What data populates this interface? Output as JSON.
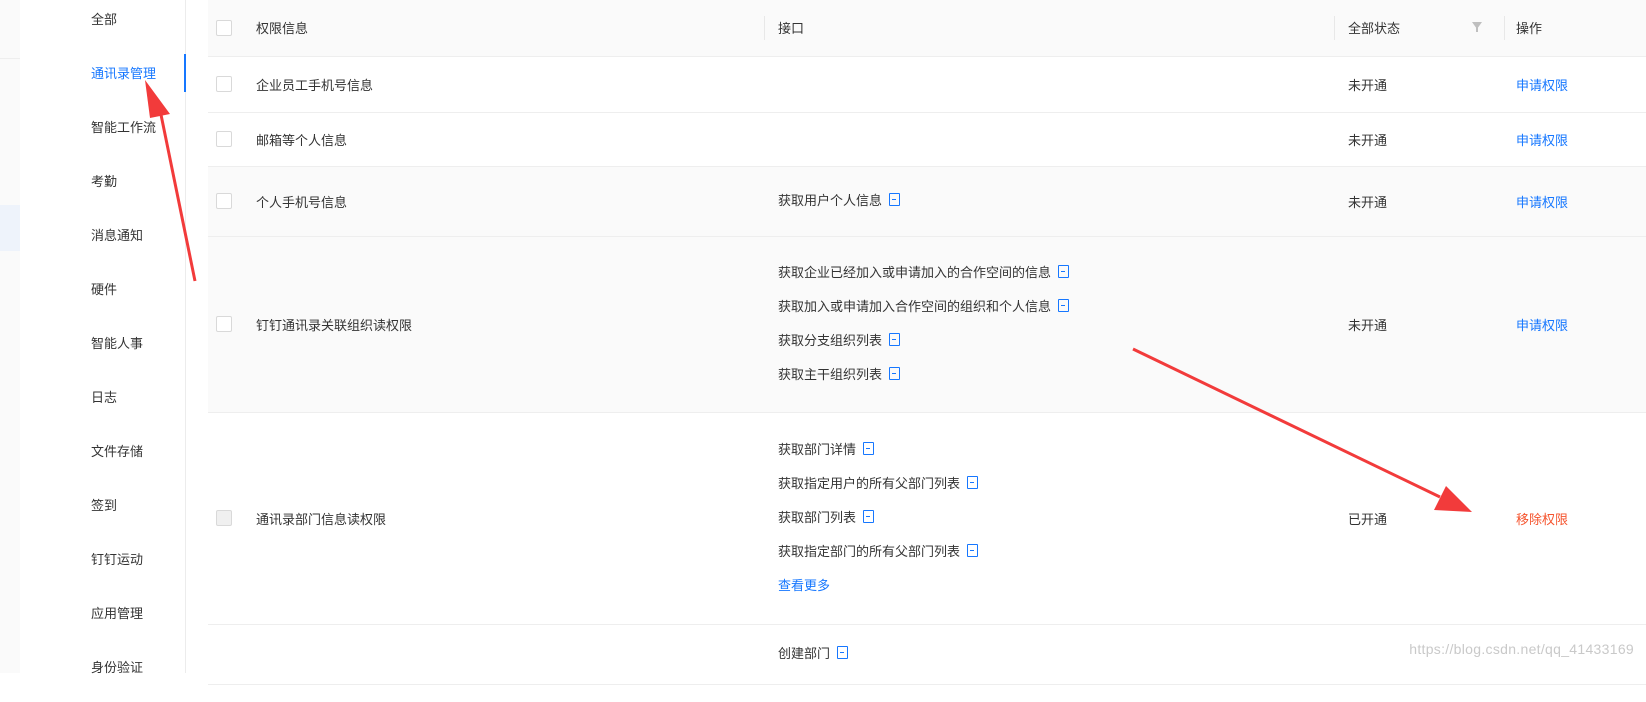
{
  "sidebar": {
    "items": [
      {
        "label": "全部",
        "active": false
      },
      {
        "label": "通讯录管理",
        "active": true
      },
      {
        "label": "智能工作流",
        "active": false
      },
      {
        "label": "考勤",
        "active": false
      },
      {
        "label": "消息通知",
        "active": false
      },
      {
        "label": "硬件",
        "active": false
      },
      {
        "label": "智能人事",
        "active": false
      },
      {
        "label": "日志",
        "active": false
      },
      {
        "label": "文件存储",
        "active": false
      },
      {
        "label": "签到",
        "active": false
      },
      {
        "label": "钉钉运动",
        "active": false
      },
      {
        "label": "应用管理",
        "active": false
      },
      {
        "label": "身份验证",
        "active": false
      }
    ]
  },
  "table": {
    "headers": {
      "name": "权限信息",
      "api": "接口",
      "state": "全部状态",
      "op": "操作"
    },
    "rows": [
      {
        "name": "企业员工手机号信息",
        "apis": [],
        "state": "未开通",
        "op": "申请权限",
        "op_type": "apply",
        "more": ""
      },
      {
        "name": "邮箱等个人信息",
        "apis": [],
        "state": "未开通",
        "op": "申请权限",
        "op_type": "apply",
        "more": ""
      },
      {
        "name": "个人手机号信息",
        "apis": [
          "获取用户个人信息"
        ],
        "state": "未开通",
        "op": "申请权限",
        "op_type": "apply",
        "more": ""
      },
      {
        "name": "钉钉通讯录关联组织读权限",
        "apis": [
          "获取企业已经加入或申请加入的合作空间的信息",
          "获取加入或申请加入合作空间的组织和个人信息",
          "获取分支组织列表",
          "获取主干组织列表"
        ],
        "state": "未开通",
        "op": "申请权限",
        "op_type": "apply",
        "more": ""
      },
      {
        "name": "通讯录部门信息读权限",
        "apis": [
          "获取部门详情",
          "获取指定用户的所有父部门列表",
          "获取部门列表",
          "获取指定部门的所有父部门列表"
        ],
        "state": "已开通",
        "op": "移除权限",
        "op_type": "remove",
        "more": "查看更多"
      },
      {
        "name": "",
        "apis": [
          "创建部门"
        ],
        "state": "",
        "op": "",
        "op_type": "",
        "more": ""
      }
    ]
  },
  "watermark": "https://blog.csdn.net/qq_41433169",
  "colors": {
    "accent": "#1677ff",
    "danger": "#f5542e",
    "annotation_arrow": "#f23b3b"
  }
}
